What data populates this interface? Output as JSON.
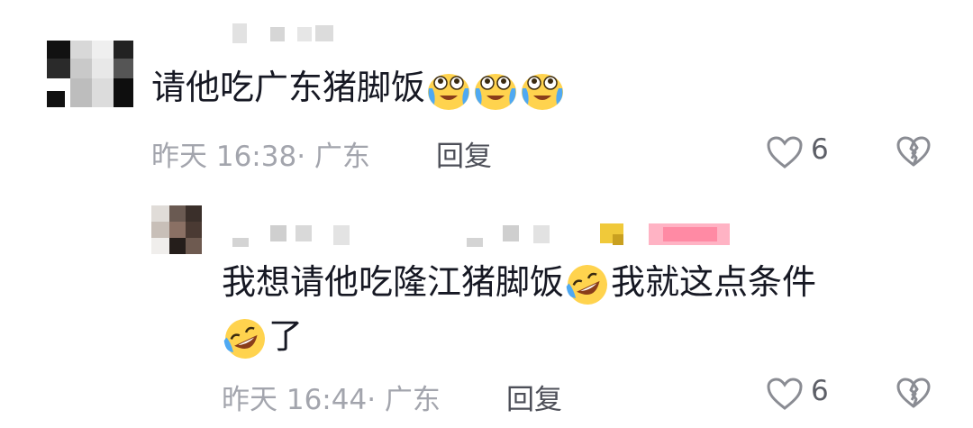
{
  "comment": {
    "text": "请他吃广东猪脚饭",
    "emojis": [
      "crying-laugh-emoji",
      "crying-laugh-emoji",
      "crying-laugh-emoji"
    ],
    "time": "昨天 16:38",
    "location": "· 广东",
    "reply_label": "回复",
    "likes": "6"
  },
  "reply": {
    "text_line1": "我想请他吃隆江猪脚饭",
    "text_line1b": "我就这点条件",
    "text_line2": "了",
    "emojis": [
      "rolling-laugh-emoji",
      "rolling-laugh-emoji"
    ],
    "time": "昨天 16:44",
    "location": "· 广东",
    "reply_label": "回复",
    "likes": "6"
  },
  "colors": {
    "text": "#161823",
    "meta": "#a3a5ad",
    "reply_button": "#4d4f58",
    "emoji_face": "#ffd34e"
  },
  "icons": [
    "heart-outline-icon",
    "broken-heart-icon"
  ]
}
